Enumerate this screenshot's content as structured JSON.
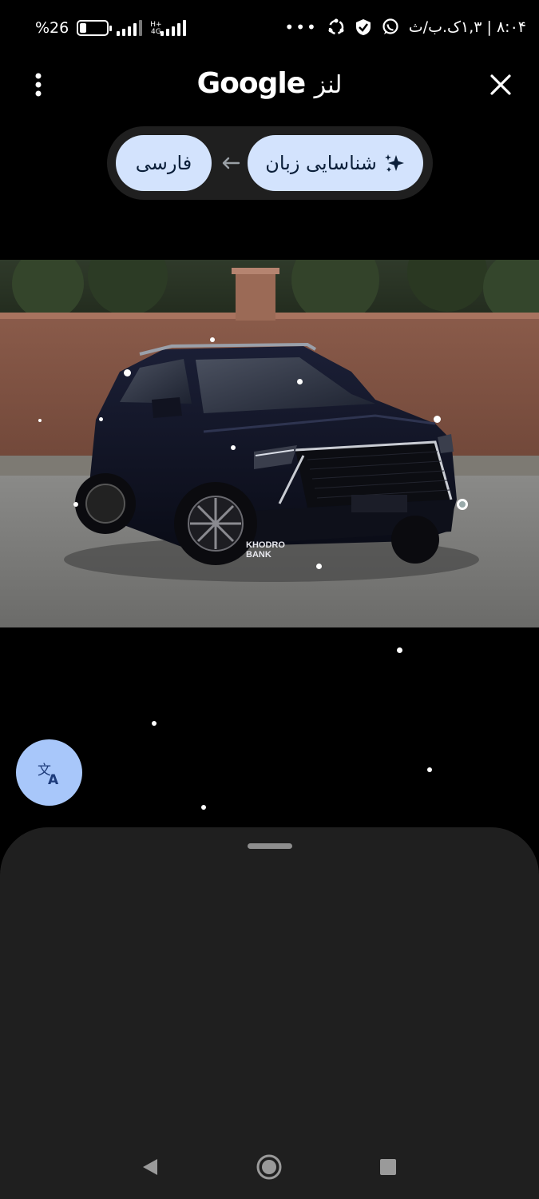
{
  "status_bar": {
    "battery_text": "%26",
    "battery_level": 0.26,
    "network_label": "H+",
    "network_label2": "4G",
    "overflow_dots": "•••",
    "time_text": "۸:۰۴ | ۱,۳ک.ب/ث"
  },
  "header": {
    "title_brand": "Google",
    "title_fa": "لنز",
    "menu_icon": "more-vert-icon",
    "close_icon": "close-icon"
  },
  "language": {
    "source_label": "شناسایی زبان",
    "source_icon": "sparkle-icon",
    "arrow_icon": "arrow-left-icon",
    "target_label": "فارسی"
  },
  "photo": {
    "watermark_line1": "KHODRO",
    "watermark_line2": "BANK"
  },
  "fab": {
    "icon": "translate-icon"
  },
  "colors": {
    "background": "#000000",
    "pill_bg": "#1f1f1f",
    "chip_bg": "#d3e3fd",
    "fab_bg": "#a8c7fa",
    "sheet_bg": "#1f1f1f"
  },
  "nav": {
    "back_icon": "back-triangle-icon",
    "home_icon": "home-circle-icon",
    "recents_icon": "recents-square-icon"
  }
}
